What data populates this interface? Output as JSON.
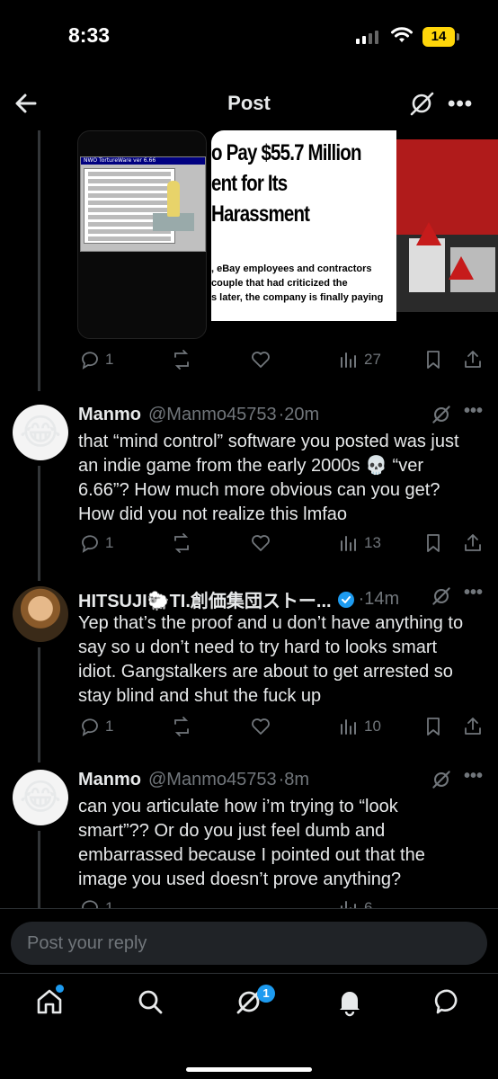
{
  "status_bar": {
    "time": "8:33",
    "battery": "14"
  },
  "header": {
    "title": "Post",
    "back_icon": "arrow-left-icon",
    "grok_icon": "grok-icon",
    "more_icon": "more-icon"
  },
  "media": {
    "left": {
      "window_title": "NWO TortureWare ver 6.66"
    },
    "right": {
      "headline_lines": [
        "o Pay $55.7 Million",
        "ent for Its",
        "Harassment"
      ],
      "body_lines": [
        ", eBay employees and contractors",
        "couple that had criticized the",
        "s later, the company is finally paying"
      ]
    }
  },
  "first_actions": {
    "replies": "1",
    "views": "27"
  },
  "tweets": [
    {
      "name": "Manmo",
      "handle": "@Manmo45753",
      "time": "·20m",
      "avatar": "face-tears-of-joy",
      "text": "that “mind control” software you posted was just an indie game from the early 2000s 💀 “ver 6.66”? How much more obvious can you get? How did you not realize this lmfao",
      "replies": "1",
      "views": "13"
    },
    {
      "name": "HITSUJI🐑TI.創価集団ストー...",
      "handle": "",
      "time": "·14m",
      "avatar": "profile-photo",
      "verified": true,
      "text": "Yep that’s the proof and u don’t have anything to say so u don’t need to try hard to looks smart idiot. Gangstalkers are about to get arrested so stay blind and shut the fuck up",
      "replies": "1",
      "views": "10"
    },
    {
      "name": "Manmo",
      "handle": "@Manmo45753",
      "time": "·8m",
      "avatar": "face-tears-of-joy",
      "text": "can you articulate how i’m trying to “look smart”?? Or do you just feel dumb and embarrassed because I pointed out that the image you used doesn’t prove anything?",
      "replies": "1",
      "views": "6"
    }
  ],
  "reply": {
    "placeholder": "Post your reply"
  },
  "nav": {
    "items": [
      "home-icon",
      "search-icon",
      "grok-icon",
      "notifications-icon",
      "messages-icon"
    ],
    "grok_badge": "1"
  },
  "colors": {
    "accent": "#1d9bf0",
    "muted": "#71767b",
    "background": "#000000"
  }
}
